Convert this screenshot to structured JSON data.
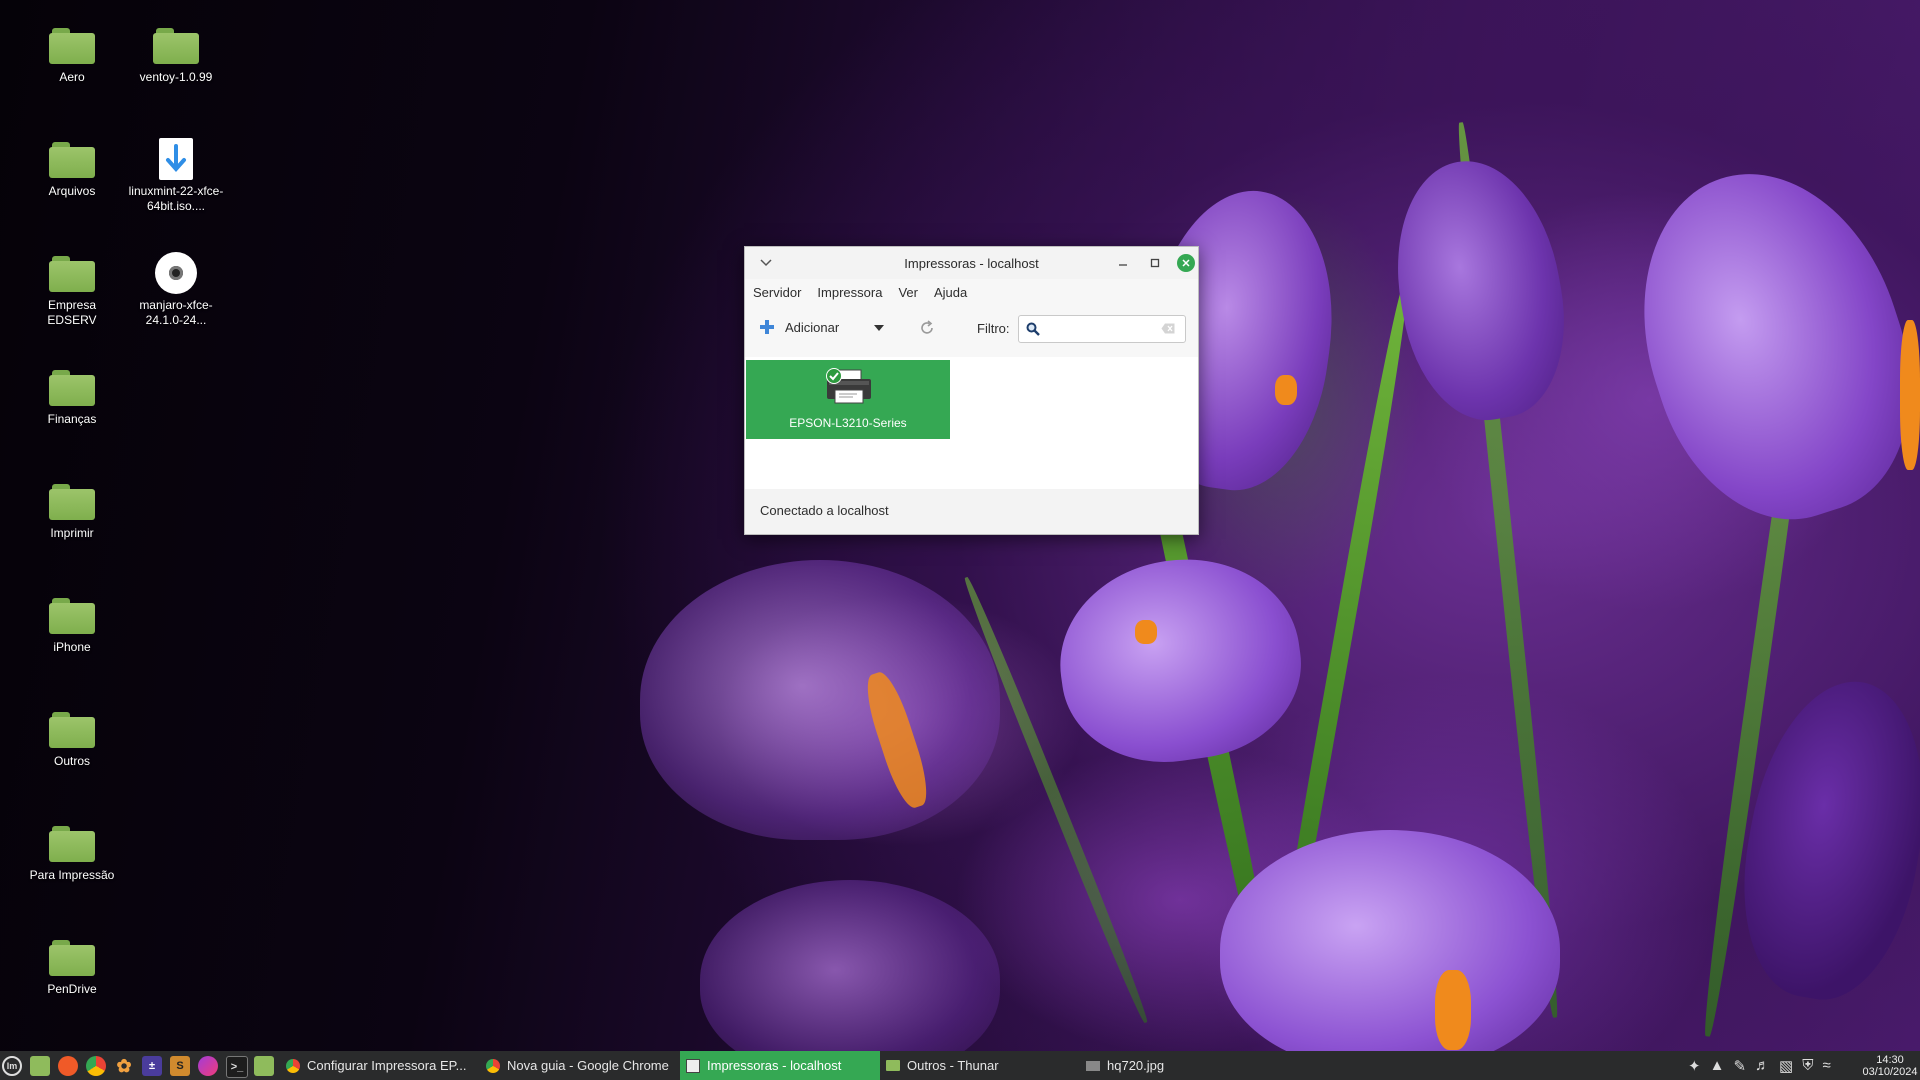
{
  "desktop": {
    "icons": [
      {
        "label": "Aero",
        "type": "folder"
      },
      {
        "label": "ventoy-1.0.99",
        "type": "folder"
      },
      {
        "label": "Arquivos",
        "type": "folder"
      },
      {
        "label": "linuxmint-22-xfce-64bit.iso....",
        "type": "download-file"
      },
      {
        "label": "Empresa EDSERV",
        "type": "folder"
      },
      {
        "label": "manjaro-xfce-24.1.0-24...",
        "type": "disc-image"
      },
      {
        "label": "Finanças",
        "type": "folder"
      },
      {
        "label": "Imprimir",
        "type": "folder"
      },
      {
        "label": "iPhone",
        "type": "folder"
      },
      {
        "label": "Outros",
        "type": "folder"
      },
      {
        "label": "Para Impressão",
        "type": "folder"
      },
      {
        "label": "PenDrive",
        "type": "folder"
      }
    ]
  },
  "window": {
    "title": "Impressoras - localhost",
    "menu": [
      "Servidor",
      "Impressora",
      "Ver",
      "Ajuda"
    ],
    "toolbar": {
      "add_label": "Adicionar",
      "filter_label": "Filtro:",
      "filter_value": ""
    },
    "printers": [
      {
        "name": "EPSON-L3210-Series",
        "is_default": true
      }
    ],
    "status": "Conectado a localhost"
  },
  "taskbar": {
    "tasks": [
      {
        "label": "Configurar Impressora EP...",
        "icon": "chrome-icon",
        "active": false
      },
      {
        "label": "Nova guia - Google Chrome",
        "icon": "chrome-icon",
        "active": false
      },
      {
        "label": "Impressoras - localhost",
        "icon": "printer-icon",
        "active": true
      },
      {
        "label": "Outros - Thunar",
        "icon": "folder-icon",
        "active": false
      },
      {
        "label": "hq720.jpg",
        "icon": "image-icon",
        "active": false
      }
    ],
    "clock": {
      "time": "14:30",
      "date": "03/10/2024"
    }
  },
  "colors": {
    "accent": "#35a853",
    "taskbar": "#2a2b2c",
    "folder": "#8fbb5c"
  }
}
